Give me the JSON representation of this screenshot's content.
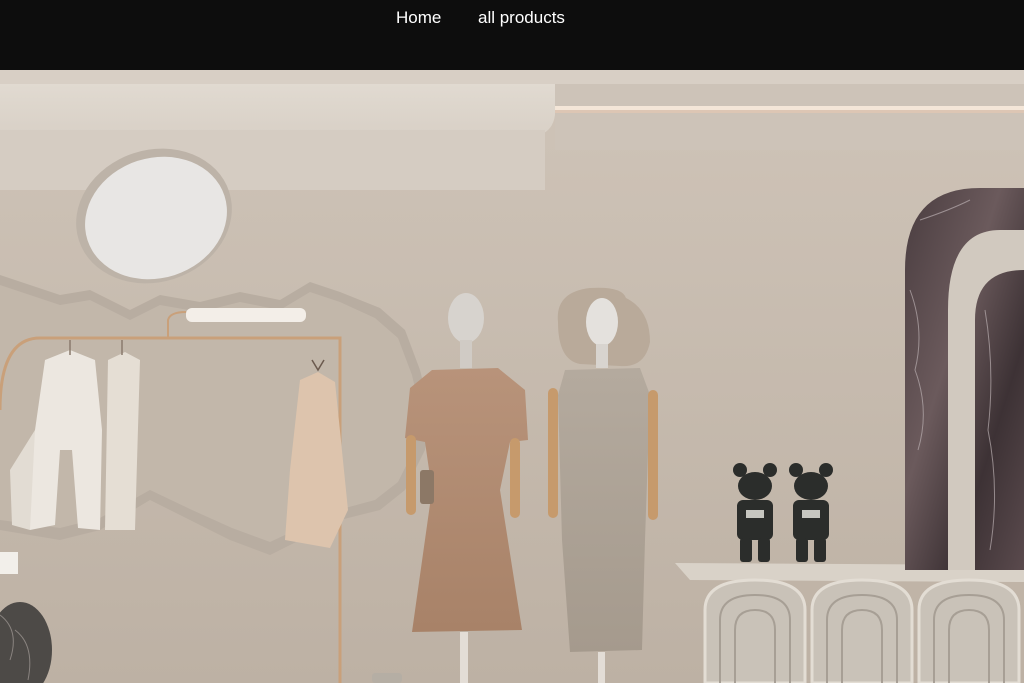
{
  "nav": {
    "home_label": "Home",
    "products_label": "all products"
  },
  "hero": {
    "image_description_icon": "boutique-showroom-image",
    "colors": {
      "navbar_bg": "#0d0d0d",
      "nav_text": "#ffffff",
      "wall": "#c8bcb0",
      "ceiling": "#d9d1c7"
    }
  }
}
